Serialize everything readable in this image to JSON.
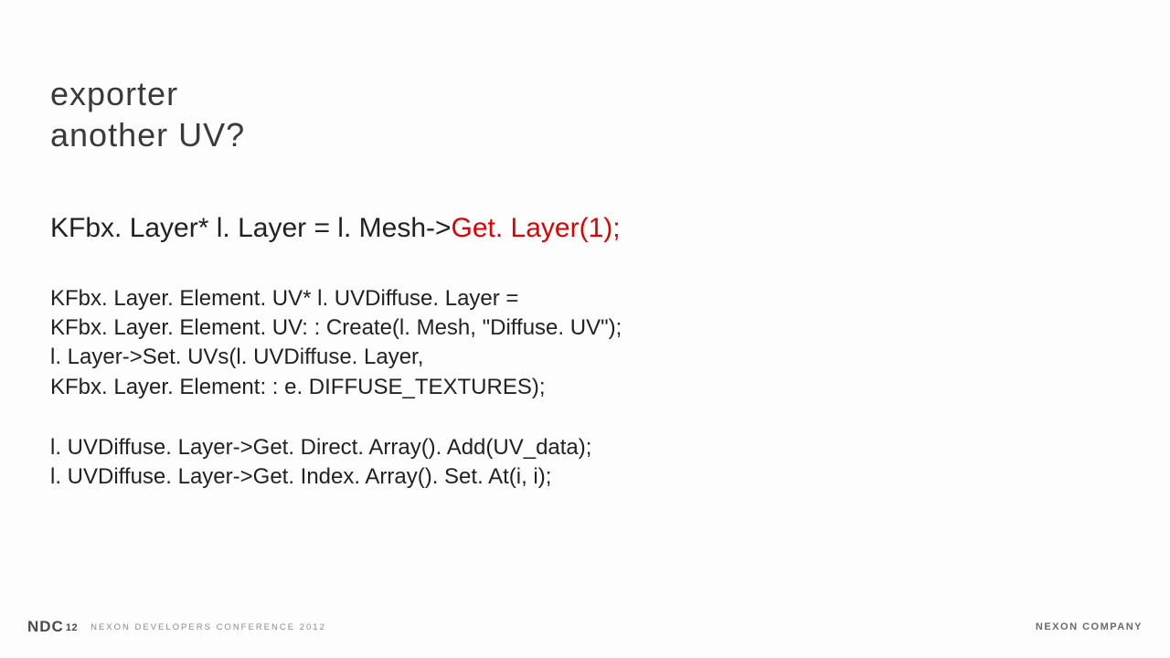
{
  "title": {
    "line1": "exporter",
    "line2": "another UV?"
  },
  "code": {
    "line1a": "KFbx. Layer* l. Layer = l. Mesh->",
    "line1b": "Get. Layer(1);",
    "block1_line1": "KFbx. Layer. Element. UV* l. UVDiffuse. Layer =",
    "block1_line2": "KFbx. Layer. Element. UV: : Create(l. Mesh, \"Diffuse. UV\");",
    "block1_line3": "l. Layer->Set. UVs(l. UVDiffuse. Layer,",
    "block1_line4": "KFbx. Layer. Element: : e. DIFFUSE_TEXTURES);",
    "block2_line1": "l. UVDiffuse. Layer->Get. Direct. Array(). Add(UV_data);",
    "block2_line2": "l. UVDiffuse. Layer->Get. Index. Array(). Set. At(i, i);"
  },
  "footer": {
    "ndc_main": "NDC",
    "ndc_year": "12",
    "ndc_sub": "NEXON DEVELOPERS CONFERENCE 2012",
    "company": "NEXON COMPANY"
  }
}
